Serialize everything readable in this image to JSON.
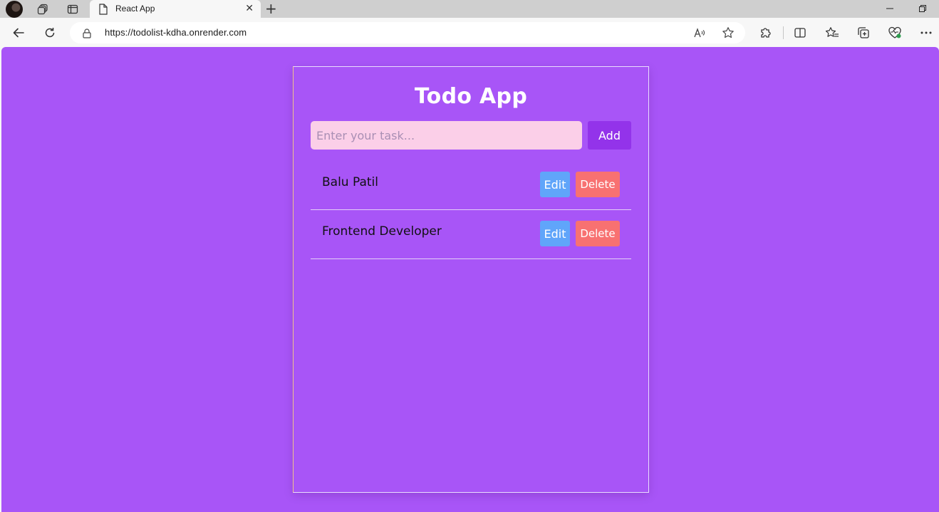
{
  "browser": {
    "tab_title": "React App",
    "tab_close_glyph": "✕",
    "new_tab_glyph": "+",
    "url_scheme": "https://",
    "url_host": "todolist-kdha.onrender.com",
    "icons": {
      "profile": "profile-avatar",
      "workspaces": "workspaces-icon",
      "tab_actions": "tab-actions-icon",
      "page": "page-icon",
      "back": "back-arrow-icon",
      "refresh": "refresh-icon",
      "lock": "lock-icon",
      "read_aloud": "read-aloud-icon",
      "favorite": "star-icon",
      "extensions": "puzzle-icon",
      "split_screen": "split-screen-icon",
      "favorites": "favorites-icon",
      "collections": "collections-icon",
      "performance": "heartbeat-icon",
      "more": "more-icon",
      "minimize": "minimize-icon",
      "restore": "restore-icon"
    }
  },
  "app": {
    "title": "Todo App",
    "input_placeholder": "Enter your task...",
    "input_value": "",
    "add_label": "Add",
    "todos": [
      {
        "text": "Balu Patil",
        "edit_label": "Edit",
        "delete_label": "Delete"
      },
      {
        "text": "Frontend Developer",
        "edit_label": "Edit",
        "delete_label": "Delete"
      }
    ]
  },
  "colors": {
    "page_bg": "#a855f7",
    "input_bg": "#fbcfe8",
    "add_btn": "#9333ea",
    "edit_btn": "#60a5fa",
    "delete_btn": "#f87171"
  }
}
